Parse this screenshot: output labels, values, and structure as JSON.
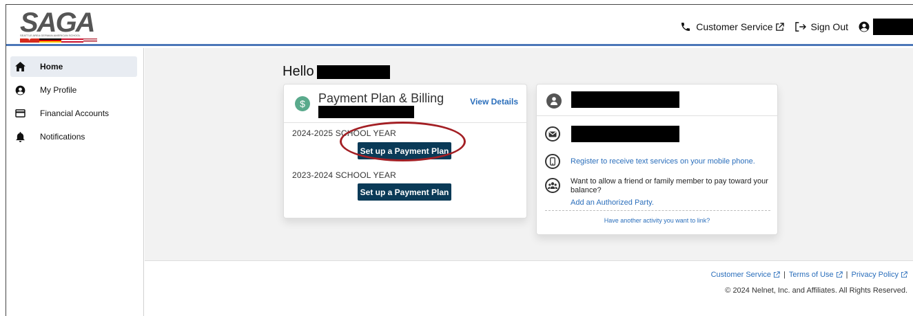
{
  "brand": {
    "logo_text": "SAGA",
    "logo_subtitle": "SEATTLE AREA GERMAN AMERICAN SCHOOL"
  },
  "header": {
    "customer_service": "Customer Service",
    "sign_out": "Sign Out"
  },
  "sidebar": {
    "items": [
      {
        "label": "Home",
        "icon": "home-icon",
        "active": true
      },
      {
        "label": "My Profile",
        "icon": "user-circle-icon"
      },
      {
        "label": "Financial Accounts",
        "icon": "credit-card-icon"
      },
      {
        "label": "Notifications",
        "icon": "bell-icon"
      }
    ]
  },
  "main": {
    "greeting": "Hello",
    "billing_card": {
      "title": "Payment Plan & Billing",
      "view_details": "View Details",
      "years": [
        {
          "label": "2024-2025 SCHOOL YEAR",
          "button": "Set up a Payment Plan"
        },
        {
          "label": "2023-2024 SCHOOL YEAR",
          "button": "Set up a Payment Plan"
        }
      ]
    },
    "contact_card": {
      "register_text": "Register to receive text services on your mobile phone.",
      "authorized_text": "Want to allow a friend or family member to pay toward your balance?",
      "authorized_link": "Add an Authorized Party.",
      "another_activity": "Have another activity you want to link?"
    }
  },
  "footer": {
    "links": [
      "Customer Service",
      "Terms of Use",
      "Privacy Policy"
    ],
    "copyright": "© 2024 Nelnet, Inc. and Affiliates. All Rights Reserved."
  },
  "colors": {
    "accent": "#4b76b8",
    "button": "#0a3a57",
    "link": "#2a6ebb",
    "highlight": "#a31f24"
  }
}
